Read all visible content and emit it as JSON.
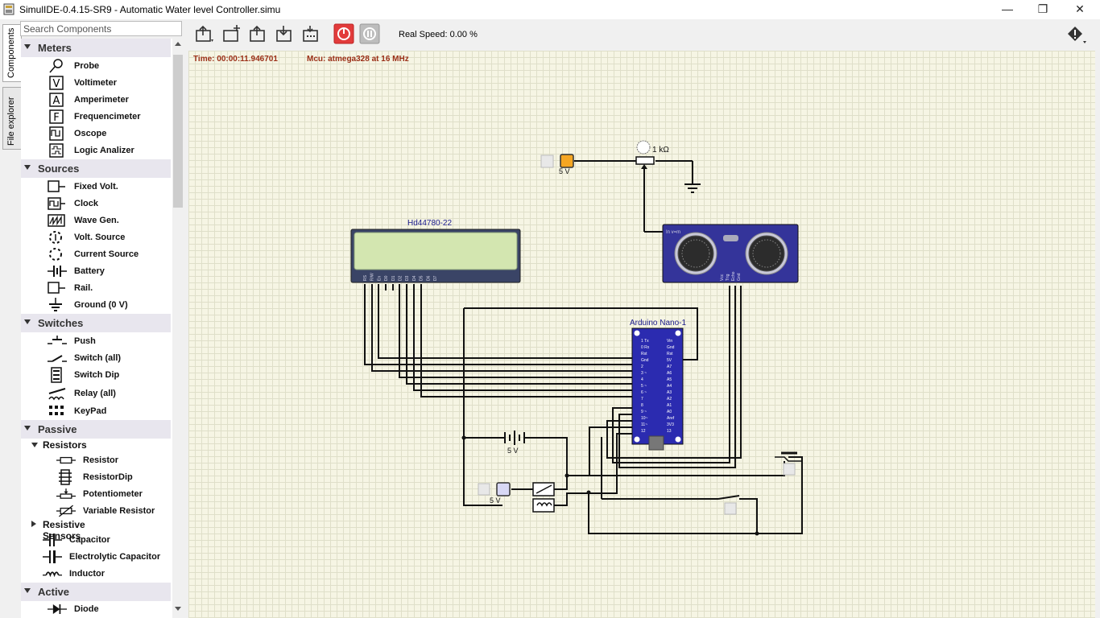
{
  "window": {
    "title": "SimulIDE-0.4.15-SR9  -  Automatic Water level Controller.simu",
    "minimize": "—",
    "maximize": "❐",
    "close": "✕"
  },
  "side_tabs": [
    "Components",
    "File explorer"
  ],
  "search": {
    "placeholder": "Search Components",
    "value": ""
  },
  "categories": [
    {
      "label": "Meters",
      "items": [
        {
          "label": "Probe",
          "icon": "probe-icon"
        },
        {
          "label": "Voltimeter",
          "icon": "voltimeter-icon"
        },
        {
          "label": "Amperimeter",
          "icon": "amperimeter-icon"
        },
        {
          "label": "Frequencimeter",
          "icon": "frequencimeter-icon"
        },
        {
          "label": "Oscope",
          "icon": "oscope-icon"
        },
        {
          "label": "Logic Analizer",
          "icon": "logic-analizer-icon"
        }
      ]
    },
    {
      "label": "Sources",
      "items": [
        {
          "label": "Fixed Volt.",
          "icon": "fixed-volt-icon"
        },
        {
          "label": "Clock",
          "icon": "clock-icon"
        },
        {
          "label": "Wave Gen.",
          "icon": "wave-gen-icon"
        },
        {
          "label": "Volt. Source",
          "icon": "volt-source-icon"
        },
        {
          "label": "Current Source",
          "icon": "current-source-icon"
        },
        {
          "label": "Battery",
          "icon": "battery-icon"
        },
        {
          "label": "Rail.",
          "icon": "rail-icon"
        },
        {
          "label": "Ground (0 V)",
          "icon": "ground-icon"
        }
      ]
    },
    {
      "label": "Switches",
      "items": [
        {
          "label": "Push",
          "icon": "push-icon"
        },
        {
          "label": "Switch (all)",
          "icon": "switch-icon"
        },
        {
          "label": "Switch Dip",
          "icon": "switch-dip-icon"
        },
        {
          "label": "Relay (all)",
          "icon": "relay-icon"
        },
        {
          "label": "KeyPad",
          "icon": "keypad-icon"
        }
      ]
    },
    {
      "label": "Passive",
      "subgroups": [
        {
          "label": "Resistors",
          "expanded": true,
          "items": [
            {
              "label": "Resistor",
              "icon": "resistor-icon"
            },
            {
              "label": "ResistorDip",
              "icon": "resistor-dip-icon"
            },
            {
              "label": "Potentiometer",
              "icon": "potentiometer-icon"
            },
            {
              "label": "Variable Resistor",
              "icon": "variable-resistor-icon"
            }
          ]
        },
        {
          "label": "Resistive Sensors",
          "expanded": false,
          "items": []
        }
      ],
      "items": [
        {
          "label": "Capacitor",
          "icon": "capacitor-icon"
        },
        {
          "label": "Electrolytic Capacitor",
          "icon": "electrolytic-capacitor-icon"
        },
        {
          "label": "Inductor",
          "icon": "inductor-icon"
        }
      ]
    },
    {
      "label": "Active",
      "items": [
        {
          "label": "Diode",
          "icon": "diode-icon"
        }
      ]
    }
  ],
  "toolbar": {
    "real_speed": "Real Speed: 0.00 %",
    "buttons": [
      "open-file",
      "new-circuit",
      "open-circuit",
      "save-circuit",
      "save-as",
      "power-on",
      "pause"
    ]
  },
  "simulation": {
    "time": "Time: 00:00:11.946701",
    "mcu": "Mcu: atmega328 at 16 MHz"
  },
  "circuit": {
    "lcd_label": "Hd44780-22",
    "lcd_pins": [
      "RS",
      "R/W",
      "En",
      "D0",
      "D1",
      "D2",
      "D3",
      "D4",
      "D5",
      "D6",
      "D7"
    ],
    "arduino_label": "Arduino Nano-1",
    "arduino_left_pins": [
      "1 Tx",
      "0 Rx",
      "Rst",
      "Gnd",
      "2",
      "3 ~",
      "4",
      "5 ~",
      "6 ~",
      "7",
      "8",
      "9 ~",
      "10~",
      "11~",
      "12"
    ],
    "arduino_right_pins": [
      "Vin",
      "Gnd",
      "Rst",
      "5V",
      "A7",
      "A6",
      "A5",
      "A4",
      "A3",
      "A2",
      "A1",
      "A0",
      "Aref",
      "3V3",
      "13"
    ],
    "pot_value": "1 kΩ",
    "source1_value": "5 V",
    "source2_value": "5 V",
    "battery_value": "5 V",
    "sensor_label": "In v=m",
    "sensor_pins": [
      "Vcc",
      "Trig",
      "Echo",
      "Gnd"
    ]
  },
  "colors": {
    "canvas_bg": "#f6f5e4",
    "grid": "#dfdfc9",
    "status_text": "#9a2e16",
    "lcd_body": "#3a4466",
    "lcd_screen": "#d3e6b0",
    "arduino_board": "#2b2bb0",
    "sensor_board": "#34349a",
    "source_led": "#f5a623"
  }
}
